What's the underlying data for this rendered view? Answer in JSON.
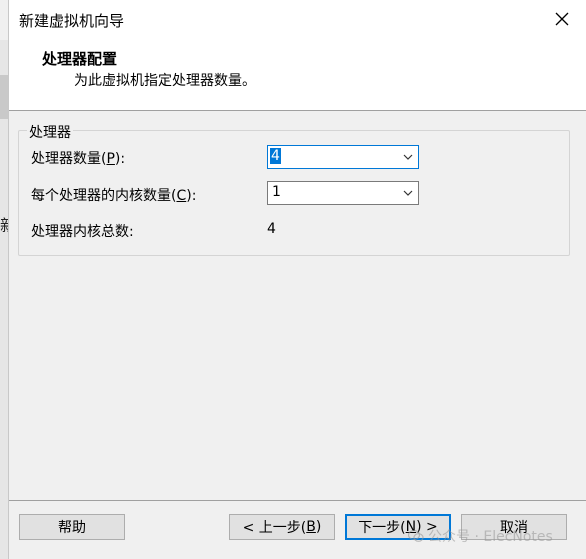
{
  "window": {
    "title": "新建虚拟机向导"
  },
  "header": {
    "title": "处理器配置",
    "subtitle": "为此虚拟机指定处理器数量。"
  },
  "background": {
    "partial_char": "新"
  },
  "group": {
    "legend": "处理器",
    "processors": {
      "label_prefix": "处理器数量(",
      "label_key": "P",
      "label_suffix": "):",
      "value": "4"
    },
    "cores": {
      "label_prefix": "每个处理器的内核数量(",
      "label_key": "C",
      "label_suffix": "):",
      "value": "1"
    },
    "total": {
      "label": "处理器内核总数:",
      "value": "4"
    }
  },
  "buttons": {
    "help": "帮助",
    "back_prefix": "< 上一步(",
    "back_key": "B",
    "back_suffix": ")",
    "next_prefix": "下一步(",
    "next_key": "N",
    "next_suffix": ") >",
    "cancel": "取消"
  },
  "watermark": {
    "text": "公众号 · ElecNotes"
  },
  "colors": {
    "accent": "#0078d7",
    "dialog_bg": "#f0f0f0",
    "header_bg": "#ffffff"
  }
}
